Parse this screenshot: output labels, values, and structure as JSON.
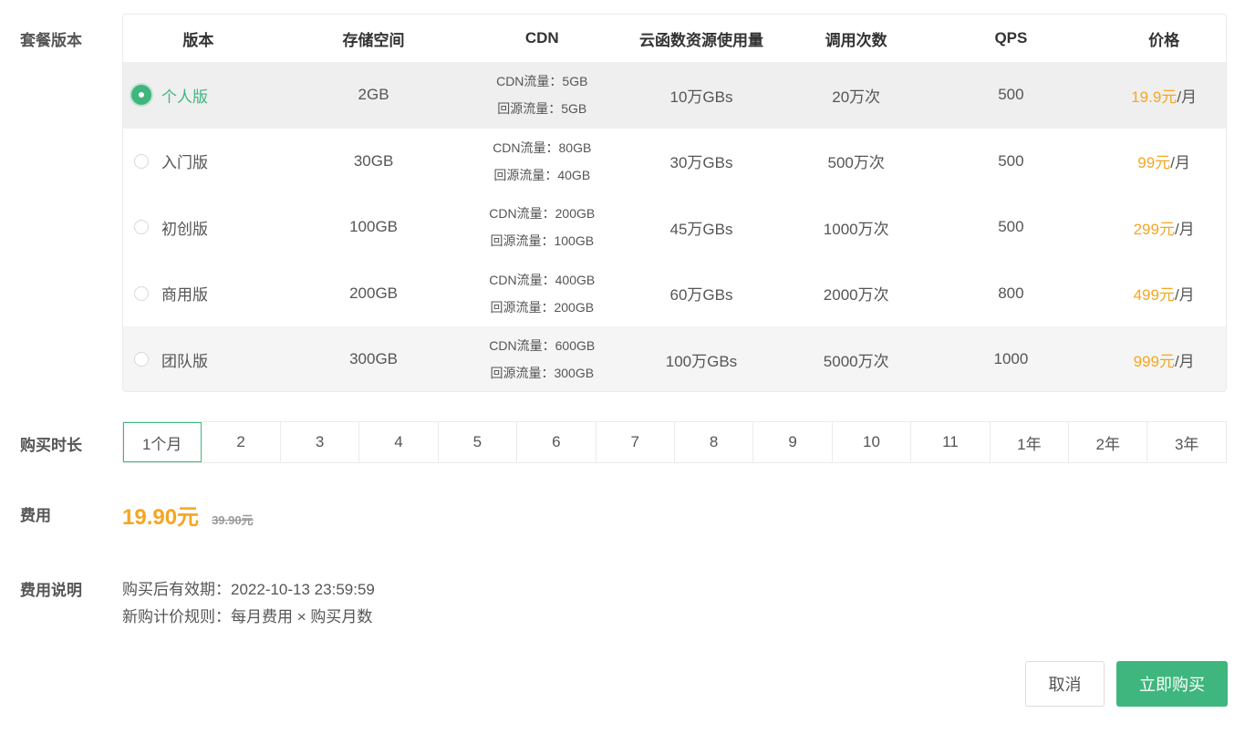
{
  "labels": {
    "plan": "套餐版本",
    "duration": "购买时长",
    "fee": "费用",
    "fee_note": "费用说明"
  },
  "table": {
    "headers": [
      "版本",
      "存储空间",
      "CDN",
      "云函数资源使用量",
      "调用次数",
      "QPS",
      "价格"
    ],
    "rows": [
      {
        "name": "个人版",
        "storage": "2GB",
        "cdn": "CDN流量：5GB",
        "origin": "回源流量：5GB",
        "fn": "10万GBs",
        "calls": "20万次",
        "qps": "500",
        "price": "19.9元",
        "unit": "/月",
        "selected": true
      },
      {
        "name": "入门版",
        "storage": "30GB",
        "cdn": "CDN流量：80GB",
        "origin": "回源流量：40GB",
        "fn": "30万GBs",
        "calls": "500万次",
        "qps": "500",
        "price": "99元",
        "unit": "/月",
        "selected": false
      },
      {
        "name": "初创版",
        "storage": "100GB",
        "cdn": "CDN流量：200GB",
        "origin": "回源流量：100GB",
        "fn": "45万GBs",
        "calls": "1000万次",
        "qps": "500",
        "price": "299元",
        "unit": "/月",
        "selected": false
      },
      {
        "name": "商用版",
        "storage": "200GB",
        "cdn": "CDN流量：400GB",
        "origin": "回源流量：200GB",
        "fn": "60万GBs",
        "calls": "2000万次",
        "qps": "800",
        "price": "499元",
        "unit": "/月",
        "selected": false
      },
      {
        "name": "团队版",
        "storage": "300GB",
        "cdn": "CDN流量：600GB",
        "origin": "回源流量：300GB",
        "fn": "100万GBs",
        "calls": "5000万次",
        "qps": "1000",
        "price": "999元",
        "unit": "/月",
        "selected": false
      }
    ]
  },
  "durations": [
    "1个月",
    "2",
    "3",
    "4",
    "5",
    "6",
    "7",
    "8",
    "9",
    "10",
    "11",
    "1年",
    "2年",
    "3年"
  ],
  "selected_duration": "1个月",
  "fee": {
    "current": "19.90元",
    "original": "39.90元"
  },
  "notes": [
    "购买后有效期：2022-10-13 23:59:59",
    "新购计价规则：每月费用 × 购买月数"
  ],
  "buttons": {
    "cancel": "取消",
    "buy": "立即购买"
  },
  "colors": {
    "accent": "#3fb67d",
    "price": "#f5a623"
  }
}
